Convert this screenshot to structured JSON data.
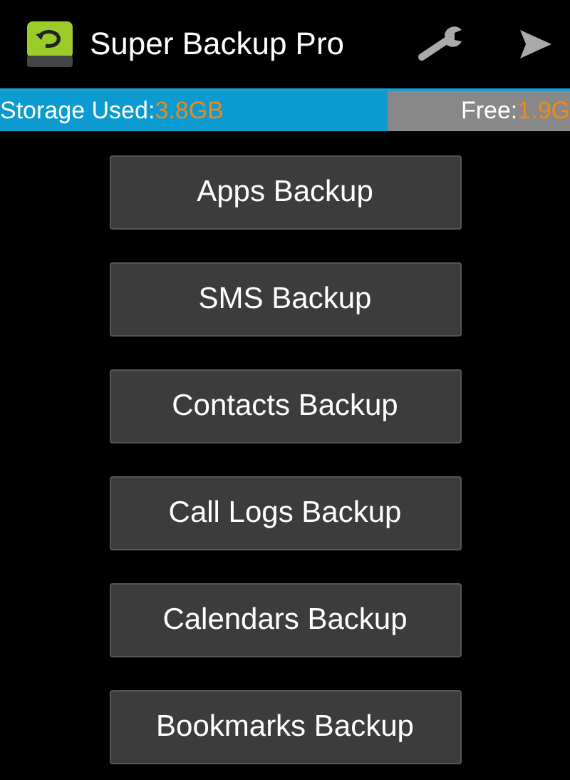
{
  "app_bar": {
    "title": "Super Backup Pro"
  },
  "storage": {
    "level": 0.68,
    "used_label": "Storage Used:",
    "used_value": "3.8GB",
    "free_label": "Free:",
    "free_value": "1.9G"
  },
  "buttons": [
    {
      "label": "Apps Backup"
    },
    {
      "label": "SMS Backup"
    },
    {
      "label": "Contacts Backup"
    },
    {
      "label": "Call Logs Backup"
    },
    {
      "label": "Calendars Backup"
    },
    {
      "label": "Bookmarks Backup"
    }
  ]
}
